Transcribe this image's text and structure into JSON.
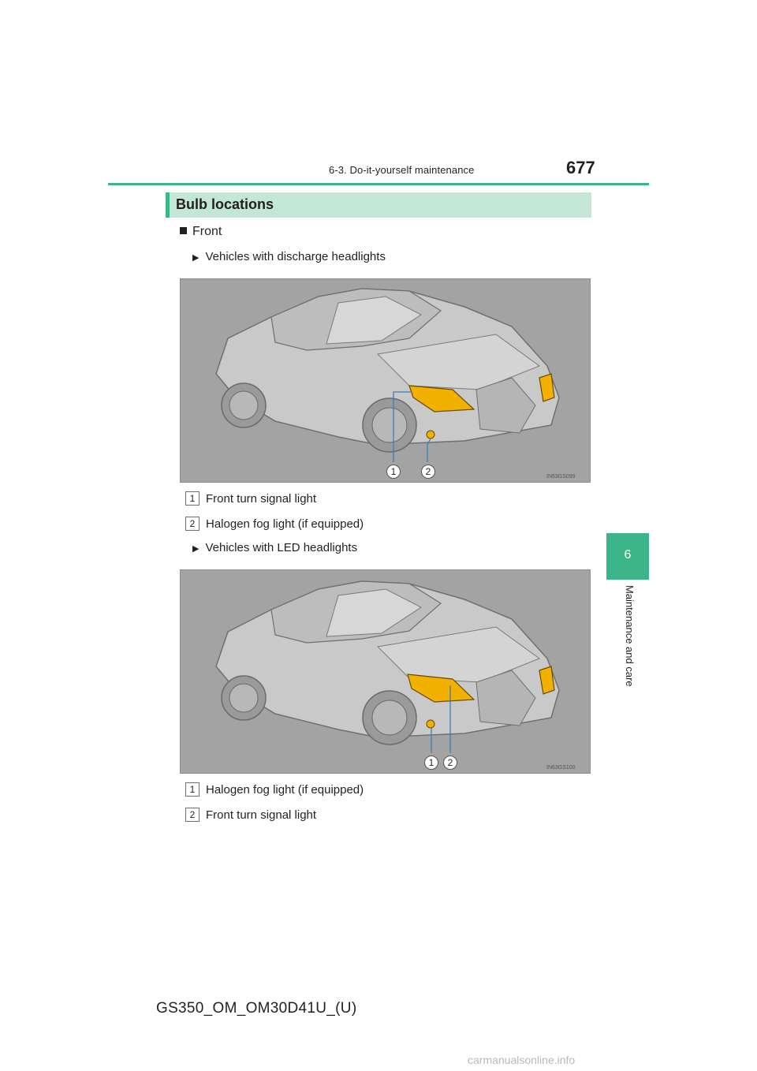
{
  "header": {
    "section": "6-3. Do-it-yourself maintenance",
    "page_number": "677"
  },
  "side_tab": {
    "number": "6",
    "label": "Maintenance and care"
  },
  "section_title": "Bulb locations",
  "subheading": "Front",
  "figures": [
    {
      "variant": "Vehicles with discharge headlights",
      "figure_code": "IN63GS099",
      "callouts": [
        "1",
        "2"
      ],
      "legend": [
        {
          "num": "1",
          "text": "Front turn signal light"
        },
        {
          "num": "2",
          "text": "Halogen fog light (if equipped)"
        }
      ]
    },
    {
      "variant": "Vehicles with LED headlights",
      "figure_code": "IN63GS100",
      "callouts": [
        "1",
        "2"
      ],
      "legend": [
        {
          "num": "1",
          "text": "Halogen fog light (if equipped)"
        },
        {
          "num": "2",
          "text": "Front turn signal light"
        }
      ]
    }
  ],
  "footer": "GS350_OM_OM30D41U_(U)",
  "watermark": "carmanualsonline.info",
  "colors": {
    "accent": "#3db58a",
    "section_bar": "#c3e6d6",
    "figure_bg": "#a3a3a3",
    "highlight_light": "#f2b100"
  }
}
